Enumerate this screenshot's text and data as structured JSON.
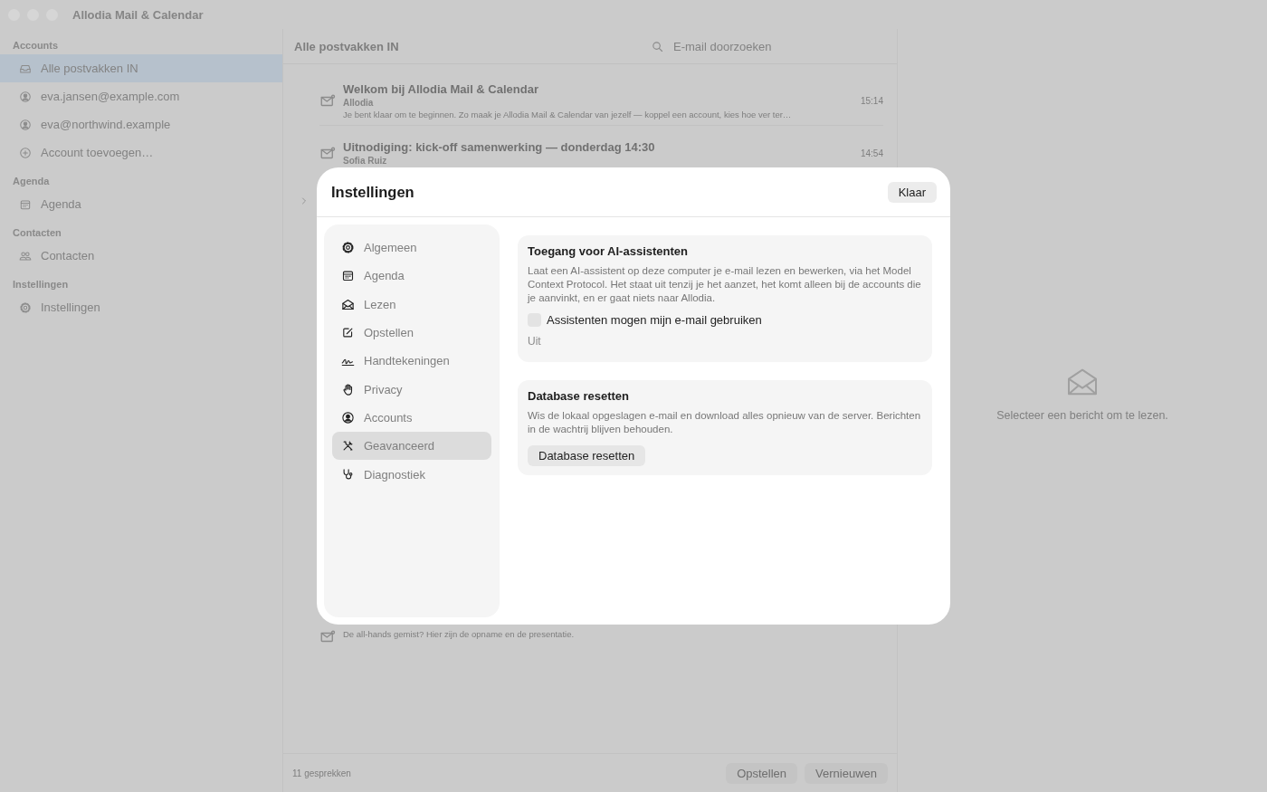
{
  "window": {
    "title": "Allodia Mail & Calendar"
  },
  "sidebar": {
    "sections": [
      {
        "heading": "Accounts",
        "items": [
          {
            "label": "Alle postvakken IN",
            "kind": "inbox",
            "selected": true
          },
          {
            "label": "eva.jansen@example.com",
            "kind": "person",
            "selected": false
          },
          {
            "label": "eva@northwind.example",
            "kind": "person",
            "selected": false
          },
          {
            "label": "Account toevoegen…",
            "kind": "plus",
            "selected": false
          }
        ]
      },
      {
        "heading": "Agenda",
        "items": [
          {
            "label": "Agenda",
            "kind": "calendar",
            "selected": false
          }
        ]
      },
      {
        "heading": "Contacten",
        "items": [
          {
            "label": "Contacten",
            "kind": "people",
            "selected": false
          }
        ]
      },
      {
        "heading": "Instellingen",
        "items": [
          {
            "label": "Instellingen",
            "kind": "gear",
            "selected": false
          }
        ]
      }
    ]
  },
  "mail_list": {
    "title": "Alle postvakken IN",
    "search": {
      "placeholder": "E-mail doorzoeken"
    },
    "messages": [
      {
        "subject": "Welkom bij Allodia Mail & Calendar",
        "sender": "Allodia",
        "preview": "Je bent klaar om te beginnen. Zo maak je Allodia Mail & Calendar van jezelf — koppel een account, kies hoe ver ter…",
        "time": "15:14"
      },
      {
        "subject": "Uitnodiging: kick-off samenwerking — donderdag 14:30",
        "sender": "Sofia Ruiz",
        "time": "14:54"
      },
      {
        "preview": "De all-hands gemist? Hier zijn de opname en de presentatie."
      }
    ]
  },
  "status_bar": {
    "count": "11 gesprekken",
    "buttons": [
      "Opstellen",
      "Vernieuwen"
    ]
  },
  "reader": {
    "empty_text": "Selecteer een bericht om te lezen."
  },
  "settings": {
    "title": "Instellingen",
    "done_button": "Klaar",
    "nav": [
      {
        "label": "Algemeen",
        "kind": "gear",
        "selected": false
      },
      {
        "label": "Agenda",
        "kind": "calendar",
        "selected": false
      },
      {
        "label": "Lezen",
        "kind": "envelope-open",
        "selected": false
      },
      {
        "label": "Opstellen",
        "kind": "compose",
        "selected": false
      },
      {
        "label": "Handtekeningen",
        "kind": "signature",
        "selected": false
      },
      {
        "label": "Privacy",
        "kind": "hand",
        "selected": false
      },
      {
        "label": "Accounts",
        "kind": "person",
        "selected": false
      },
      {
        "label": "Geavanceerd",
        "kind": "tools",
        "selected": true
      },
      {
        "label": "Diagnostiek",
        "kind": "stethoscope",
        "selected": false
      }
    ],
    "sections": [
      {
        "title": "Toegang voor AI-assistenten",
        "description": "Laat een AI-assistent op deze computer je e-mail lezen en bewerken, via het Model Context Protocol. Het staat uit tenzij je het aanzet, het komt alleen bij de accounts die je aanvinkt, en er gaat niets naar Allodia.",
        "checkbox": {
          "label": "Assistenten mogen mijn e-mail gebruiken",
          "checked": false
        },
        "status": "Uit"
      },
      {
        "title": "Database resetten",
        "description": "Wis de lokaal opgeslagen e-mail en download alles opnieuw van de server. Berichten in de wachtrij blijven behouden.",
        "button": "Database resetten"
      }
    ]
  }
}
